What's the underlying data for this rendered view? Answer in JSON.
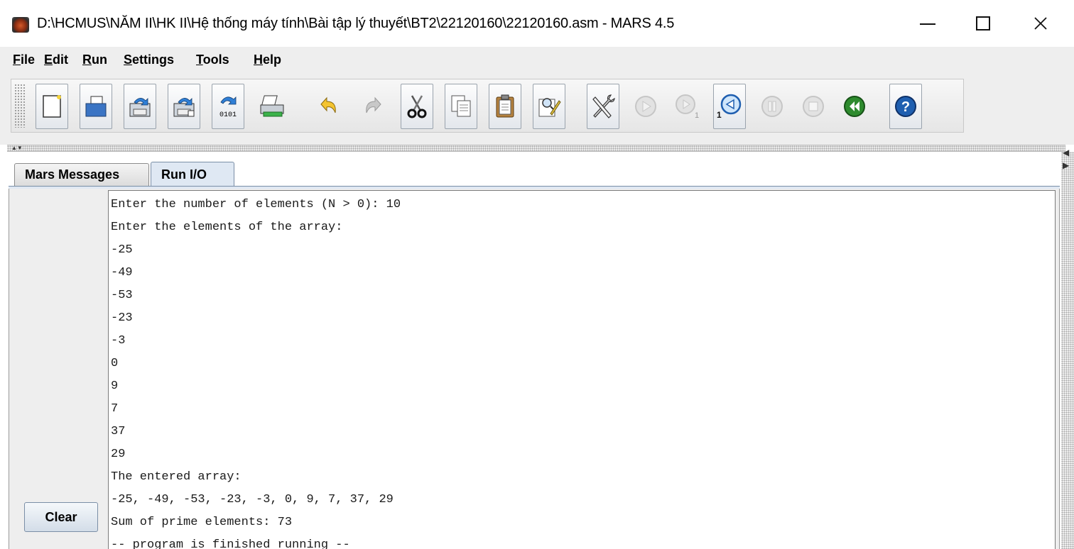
{
  "window": {
    "title": "D:\\HCMUS\\NĂM II\\HK II\\Hệ thống máy tính\\Bài tập lý thuyết\\BT2\\22120160\\22120160.asm  - MARS 4.5",
    "minimize_icon": "minimize-icon",
    "maximize_icon": "maximize-icon",
    "close_icon": "close-icon"
  },
  "menu": {
    "file": "File",
    "edit": "Edit",
    "run": "Run",
    "settings": "Settings",
    "tools": "Tools",
    "help": "Help"
  },
  "toolbar": {
    "buttons": [
      {
        "name": "new-file",
        "icon": "new-file-icon"
      },
      {
        "name": "open-file",
        "icon": "open-folder-icon"
      },
      {
        "name": "save",
        "icon": "save-icon"
      },
      {
        "name": "save-as",
        "icon": "save-as-icon"
      },
      {
        "name": "dump-memory",
        "icon": "dump-binary-icon",
        "text": "0101"
      },
      {
        "name": "print",
        "icon": "printer-icon"
      },
      {
        "name": "undo",
        "icon": "undo-icon"
      },
      {
        "name": "redo",
        "icon": "redo-icon"
      },
      {
        "name": "cut",
        "icon": "scissors-icon"
      },
      {
        "name": "copy",
        "icon": "copy-icon"
      },
      {
        "name": "paste",
        "icon": "paste-icon"
      },
      {
        "name": "find-replace",
        "icon": "find-replace-icon"
      },
      {
        "name": "assemble",
        "icon": "wrench-screwdriver-icon"
      },
      {
        "name": "run",
        "icon": "play-icon"
      },
      {
        "name": "step",
        "icon": "step-icon"
      },
      {
        "name": "backstep",
        "icon": "backstep-icon"
      },
      {
        "name": "pause",
        "icon": "pause-icon"
      },
      {
        "name": "stop",
        "icon": "stop-icon"
      },
      {
        "name": "reset",
        "icon": "reset-icon"
      },
      {
        "name": "help",
        "icon": "help-icon"
      }
    ],
    "step_subscript": "1"
  },
  "tabs": {
    "messages": "Mars Messages",
    "run_io": "Run I/O"
  },
  "console": {
    "lines": [
      "Enter the number of elements (N > 0): 10",
      "Enter the elements of the array:",
      "-25",
      "-49",
      "-53",
      "-23",
      "-3",
      "0",
      "9",
      "7",
      "37",
      "29",
      "The entered array:",
      "-25, -49, -53, -23, -3, 0, 9, 7, 37, 29",
      "Sum of prime elements: 73",
      "-- program is finished running --"
    ]
  },
  "clear_button": "Clear",
  "colors": {
    "chrome": "#eeeeee",
    "tab_active": "#dfe8f3",
    "console_bg": "#ffffff",
    "reset_green": "#2e8b2e",
    "help_blue": "#1f5fb0"
  }
}
